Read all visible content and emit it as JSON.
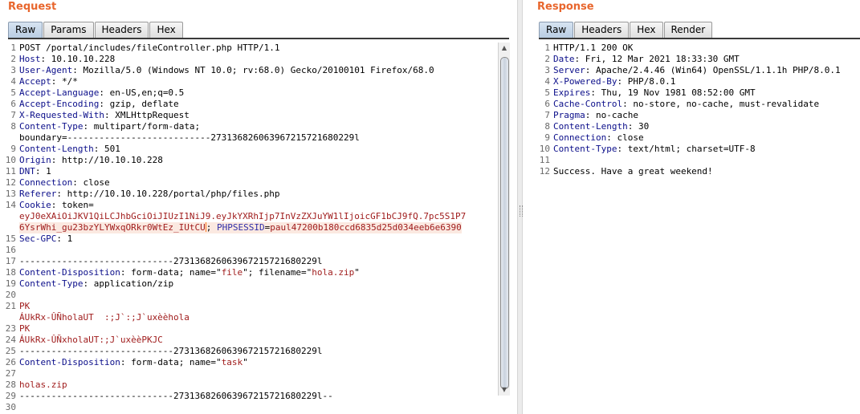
{
  "request": {
    "title": "Request",
    "tabs": [
      "Raw",
      "Params",
      "Headers",
      "Hex"
    ],
    "lines": [
      {
        "n": "1",
        "parts": [
          {
            "t": "POST /portal/includes/fileController.php HTTP/1.1",
            "c": "txt"
          }
        ]
      },
      {
        "n": "2",
        "parts": [
          {
            "t": "Host",
            "c": "hn"
          },
          {
            "t": ": 10.10.10.228",
            "c": "txt"
          }
        ]
      },
      {
        "n": "3",
        "parts": [
          {
            "t": "User-Agent",
            "c": "hn"
          },
          {
            "t": ": Mozilla/5.0 (Windows NT 10.0; rv:68.0) Gecko/20100101 Firefox/68.0",
            "c": "txt"
          }
        ]
      },
      {
        "n": "4",
        "parts": [
          {
            "t": "Accept",
            "c": "hn"
          },
          {
            "t": ": */*",
            "c": "txt"
          }
        ]
      },
      {
        "n": "5",
        "parts": [
          {
            "t": "Accept-Language",
            "c": "hn"
          },
          {
            "t": ": en-US,en;q=0.5",
            "c": "txt"
          }
        ]
      },
      {
        "n": "6",
        "parts": [
          {
            "t": "Accept-Encoding",
            "c": "hn"
          },
          {
            "t": ": gzip, deflate",
            "c": "txt"
          }
        ]
      },
      {
        "n": "7",
        "parts": [
          {
            "t": "X-Requested-With",
            "c": "hn"
          },
          {
            "t": ": XMLHttpRequest",
            "c": "txt"
          }
        ]
      },
      {
        "n": "8",
        "parts": [
          {
            "t": "Content-Type",
            "c": "hn"
          },
          {
            "t": ": multipart/form-data;",
            "c": "txt"
          }
        ]
      },
      {
        "n": "",
        "parts": [
          {
            "t": "boundary=---------------------------273136826063967215721680229l",
            "c": "txt"
          }
        ]
      },
      {
        "n": "9",
        "parts": [
          {
            "t": "Content-Length",
            "c": "hn"
          },
          {
            "t": ": 501",
            "c": "txt"
          }
        ]
      },
      {
        "n": "10",
        "parts": [
          {
            "t": "Origin",
            "c": "hn"
          },
          {
            "t": ": http://10.10.10.228",
            "c": "txt"
          }
        ]
      },
      {
        "n": "11",
        "parts": [
          {
            "t": "DNT",
            "c": "hn"
          },
          {
            "t": ": 1",
            "c": "txt"
          }
        ]
      },
      {
        "n": "12",
        "parts": [
          {
            "t": "Connection",
            "c": "hn"
          },
          {
            "t": ": close",
            "c": "txt"
          }
        ]
      },
      {
        "n": "13",
        "parts": [
          {
            "t": "Referer",
            "c": "hn"
          },
          {
            "t": ": http://10.10.10.228/portal/php/files.php",
            "c": "txt"
          }
        ]
      },
      {
        "n": "14",
        "parts": [
          {
            "t": "Cookie",
            "c": "hn"
          },
          {
            "t": ": token=",
            "c": "txt"
          }
        ]
      },
      {
        "n": "",
        "parts": [
          {
            "t": "eyJ0eXAiOiJKV1QiLCJhbGciOiJIUzI1NiJ9.eyJkYXRhIjp7InVzZXJuYW1lIjoicGF1bCJ9fQ.7pc5S1P7",
            "c": "red"
          }
        ]
      },
      {
        "n": "",
        "caret": true,
        "parts": [
          {
            "t": "6YsrWhi_gu23bzYLYWxqORkr0WtEz_IUtCU",
            "c": "red"
          },
          {
            "t": "; ",
            "c": "txt"
          },
          {
            "t": "PHPSESSID",
            "c": "blue"
          },
          {
            "t": "=",
            "c": "txt"
          },
          {
            "t": "paul47200b180ccd6835d25d034eeb6e6390",
            "c": "red"
          }
        ]
      },
      {
        "n": "15",
        "parts": [
          {
            "t": "Sec-GPC",
            "c": "hn"
          },
          {
            "t": ": 1",
            "c": "txt"
          }
        ]
      },
      {
        "n": "16",
        "parts": [
          {
            "t": "",
            "c": "txt"
          }
        ]
      },
      {
        "n": "17",
        "parts": [
          {
            "t": "-----------------------------273136826063967215721680229l",
            "c": "txt"
          }
        ]
      },
      {
        "n": "18",
        "parts": [
          {
            "t": "Content-Disposition",
            "c": "hn"
          },
          {
            "t": ": form-data; name=\"",
            "c": "txt"
          },
          {
            "t": "file",
            "c": "red"
          },
          {
            "t": "\"; filename=\"",
            "c": "txt"
          },
          {
            "t": "hola.zip",
            "c": "red"
          },
          {
            "t": "\"",
            "c": "txt"
          }
        ]
      },
      {
        "n": "19",
        "parts": [
          {
            "t": "Content-Type",
            "c": "hn"
          },
          {
            "t": ": application/zip",
            "c": "txt"
          }
        ]
      },
      {
        "n": "20",
        "parts": [
          {
            "t": "",
            "c": "txt"
          }
        ]
      },
      {
        "n": "21",
        "parts": [
          {
            "t": "PK",
            "c": "red"
          }
        ]
      },
      {
        "n": "",
        "parts": [
          {
            "t": "ÁUkRx-ÛÑholaUT  :;J`:;J`uxèèhola",
            "c": "red"
          }
        ]
      },
      {
        "n": "23",
        "parts": [
          {
            "t": "PK",
            "c": "red"
          }
        ]
      },
      {
        "n": "24",
        "parts": [
          {
            "t": "ÁUkRx-ÛÑxholaUT:;J`uxèèPKJC",
            "c": "red"
          }
        ]
      },
      {
        "n": "25",
        "parts": [
          {
            "t": "-----------------------------273136826063967215721680229l",
            "c": "txt"
          }
        ]
      },
      {
        "n": "26",
        "parts": [
          {
            "t": "Content-Disposition",
            "c": "hn"
          },
          {
            "t": ": form-data; name=\"",
            "c": "txt"
          },
          {
            "t": "task",
            "c": "red"
          },
          {
            "t": "\"",
            "c": "txt"
          }
        ]
      },
      {
        "n": "27",
        "parts": [
          {
            "t": "",
            "c": "txt"
          }
        ]
      },
      {
        "n": "28",
        "parts": [
          {
            "t": "holas.zip",
            "c": "red"
          }
        ]
      },
      {
        "n": "29",
        "parts": [
          {
            "t": "-----------------------------273136826063967215721680229l--",
            "c": "txt"
          }
        ]
      },
      {
        "n": "30",
        "parts": [
          {
            "t": "",
            "c": "txt"
          }
        ]
      }
    ]
  },
  "response": {
    "title": "Response",
    "tabs": [
      "Raw",
      "Headers",
      "Hex",
      "Render"
    ],
    "lines": [
      {
        "n": "1",
        "parts": [
          {
            "t": "HTTP/1.1 200 OK",
            "c": "txt"
          }
        ]
      },
      {
        "n": "2",
        "parts": [
          {
            "t": "Date",
            "c": "hn"
          },
          {
            "t": ": Fri, 12 Mar 2021 18:33:30 GMT",
            "c": "txt"
          }
        ]
      },
      {
        "n": "3",
        "parts": [
          {
            "t": "Server",
            "c": "hn"
          },
          {
            "t": ": Apache/2.4.46 (Win64) OpenSSL/1.1.1h PHP/8.0.1",
            "c": "txt"
          }
        ]
      },
      {
        "n": "4",
        "parts": [
          {
            "t": "X-Powered-By",
            "c": "hn"
          },
          {
            "t": ": PHP/8.0.1",
            "c": "txt"
          }
        ]
      },
      {
        "n": "5",
        "parts": [
          {
            "t": "Expires",
            "c": "hn"
          },
          {
            "t": ": Thu, 19 Nov 1981 08:52:00 GMT",
            "c": "txt"
          }
        ]
      },
      {
        "n": "6",
        "parts": [
          {
            "t": "Cache-Control",
            "c": "hn"
          },
          {
            "t": ": no-store, no-cache, must-revalidate",
            "c": "txt"
          }
        ]
      },
      {
        "n": "7",
        "parts": [
          {
            "t": "Pragma",
            "c": "hn"
          },
          {
            "t": ": no-cache",
            "c": "txt"
          }
        ]
      },
      {
        "n": "8",
        "parts": [
          {
            "t": "Content-Length",
            "c": "hn"
          },
          {
            "t": ": 30",
            "c": "txt"
          }
        ]
      },
      {
        "n": "9",
        "parts": [
          {
            "t": "Connection",
            "c": "hn"
          },
          {
            "t": ": close",
            "c": "txt"
          }
        ]
      },
      {
        "n": "10",
        "parts": [
          {
            "t": "Content-Type",
            "c": "hn"
          },
          {
            "t": ": text/html; charset=UTF-8",
            "c": "txt"
          }
        ]
      },
      {
        "n": "11",
        "parts": [
          {
            "t": "",
            "c": "txt"
          }
        ]
      },
      {
        "n": "12",
        "parts": [
          {
            "t": "Success. Have a great weekend!",
            "c": "txt"
          }
        ]
      }
    ]
  },
  "colors": {
    "title": "#e8662d",
    "header_name": "#0b0e8a",
    "value_highlight": "#a01d1d",
    "cookie_name": "#2f2fa8",
    "caret": "#ff7a1a"
  },
  "icons": {
    "scroll_up": "scroll-up-arrow-icon",
    "scroll_down": "scroll-down-arrow-icon"
  }
}
